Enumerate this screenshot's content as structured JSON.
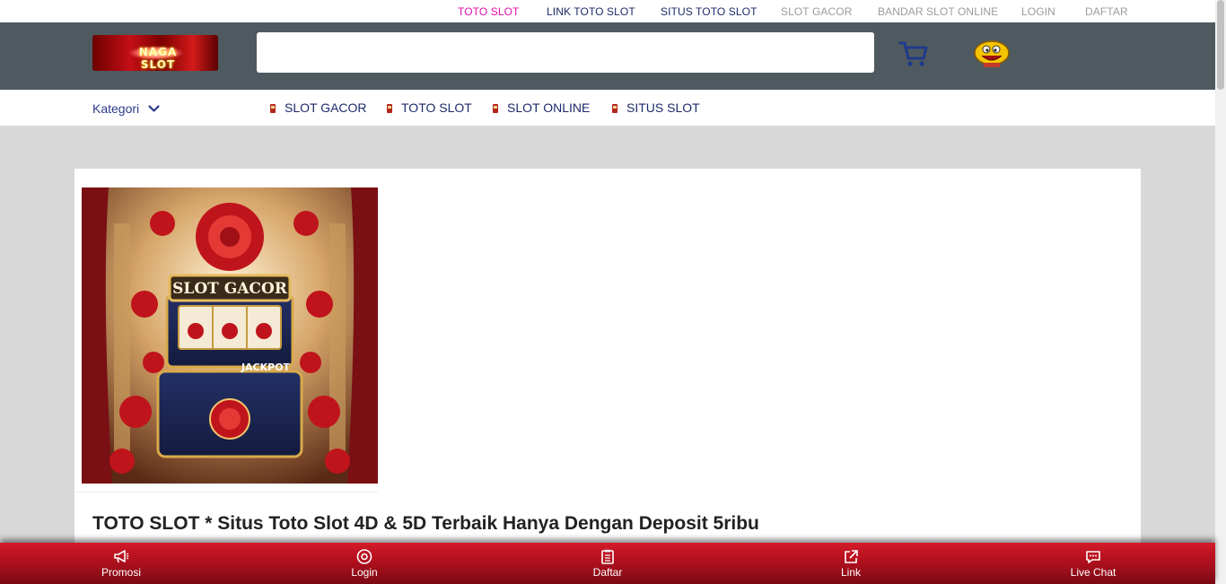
{
  "top_links": [
    {
      "label": "TOTO SLOT",
      "color": "#e20fae"
    },
    {
      "label": "LINK TOTO SLOT",
      "color": "#1d2a6b"
    },
    {
      "label": "SITUS TOTO SLOT",
      "color": "#1d2a6b"
    },
    {
      "label": "SLOT GACOR",
      "color": "#9b9b9b"
    },
    {
      "label": "BANDAR SLOT ONLINE",
      "color": "#9b9b9b"
    },
    {
      "label": "LOGIN",
      "color": "#9b9b9b"
    },
    {
      "label": "DAFTAR",
      "color": "#9b9b9b"
    }
  ],
  "header": {
    "logo_text": "NAGA SLOT",
    "search_placeholder": "",
    "cart_icon": "cart-icon",
    "avatar_icon": "emoji-avatar-icon"
  },
  "nav": {
    "kategori_label": "Kategori",
    "links": [
      "SLOT GACOR",
      "TOTO SLOT",
      "SLOT ONLINE",
      "SITUS SLOT"
    ]
  },
  "content": {
    "hero_sign": "SLOT GACOR",
    "hero_jackpot": "JACKPOT",
    "title": "TOTO SLOT * Situs Toto Slot 4D & 5D Terbaik Hanya Dengan Deposit 5ribu"
  },
  "bottom_nav": [
    {
      "label": "Promosi",
      "icon": "megaphone-icon"
    },
    {
      "label": "Login",
      "icon": "login-icon"
    },
    {
      "label": "Daftar",
      "icon": "clipboard-icon"
    },
    {
      "label": "Link",
      "icon": "external-link-icon"
    },
    {
      "label": "Live Chat",
      "icon": "chat-icon"
    }
  ],
  "colors": {
    "header_bg": "#4f5a60",
    "accent_pink": "#e20fae",
    "nav_blue": "#1d2a6b",
    "bottom_red": "#b5101e"
  }
}
